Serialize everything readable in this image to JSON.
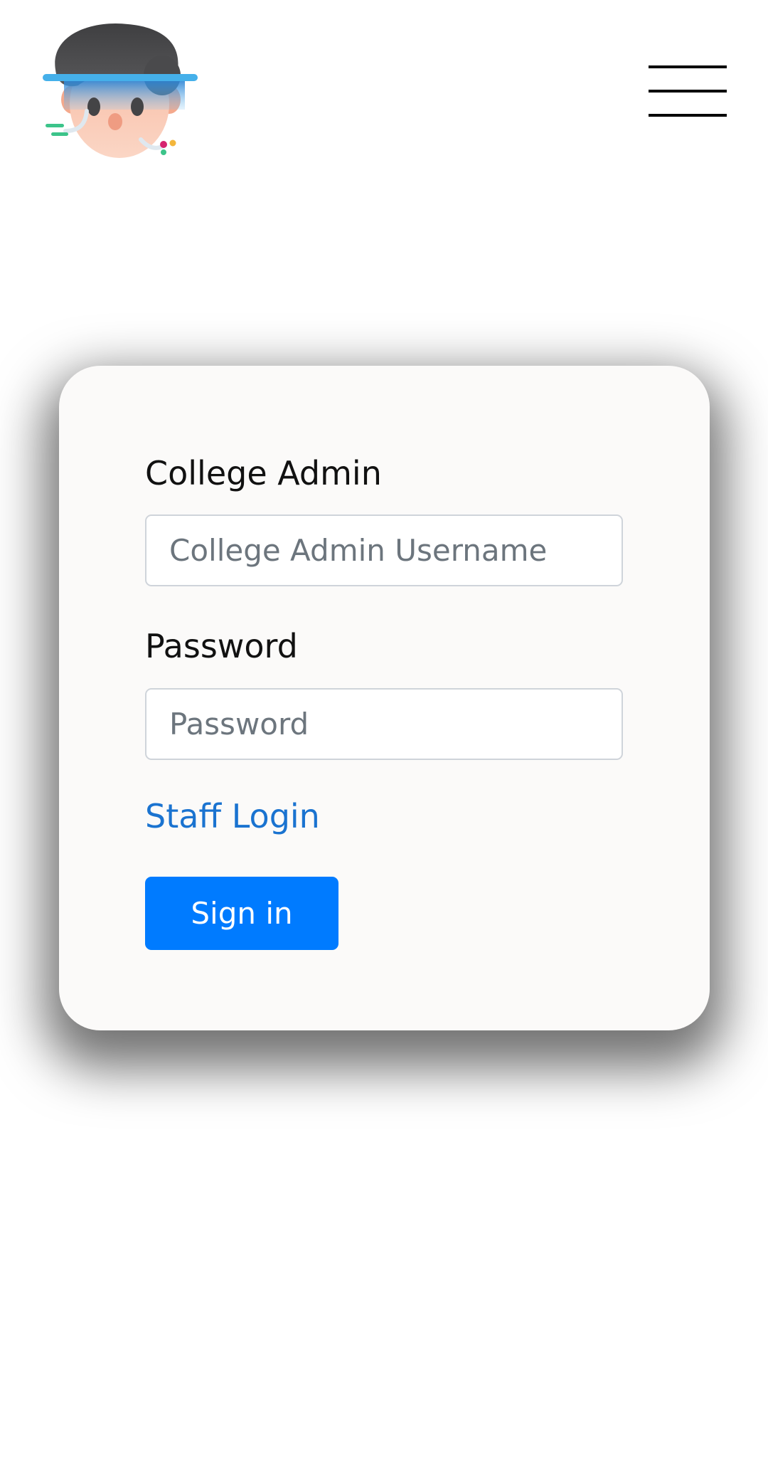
{
  "header": {
    "logo_icon": "avatar-headset-logo-icon",
    "menu_icon": "hamburger-menu-icon"
  },
  "login_form": {
    "username_label": "College Admin",
    "username_placeholder": "College Admin Username",
    "username_value": "",
    "password_label": "Password",
    "password_placeholder": "Password",
    "password_value": "",
    "staff_link": "Staff Login",
    "submit_label": "Sign in"
  },
  "colors": {
    "primary_button": "#007bff",
    "link": "#1a73d0",
    "card_background": "#fbfaf9",
    "page_background": "#ffffff"
  }
}
